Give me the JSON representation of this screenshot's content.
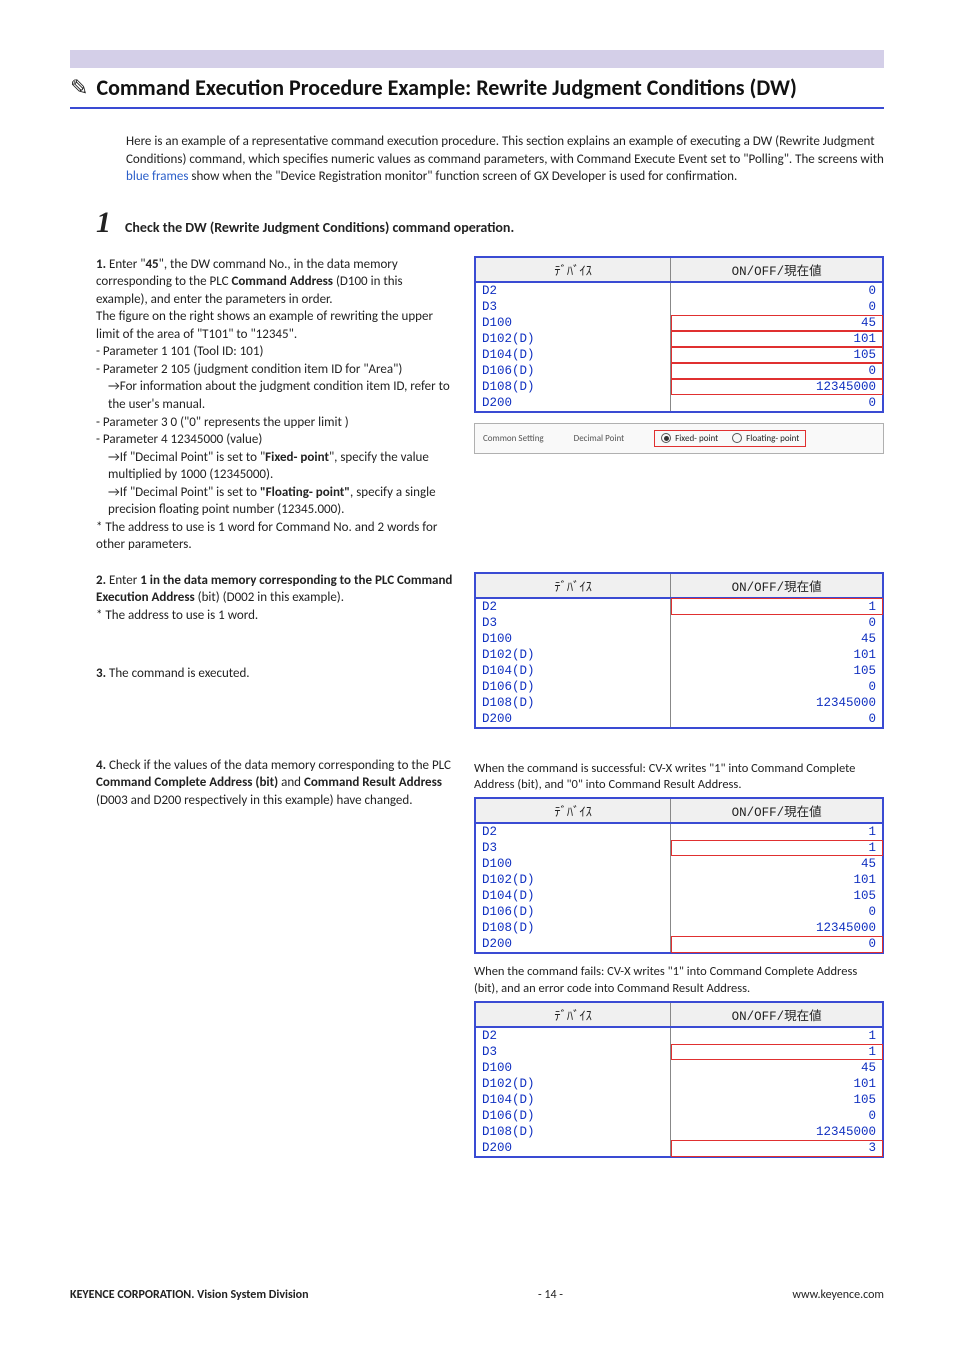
{
  "title": "Command Execution Procedure Example: Rewrite Judgment Conditions (DW)",
  "intro": {
    "p1a": "Here is an example of a representative command execution procedure. This section explains an example of executing a DW (Rewrite Judgment Conditions) command, which specifies numeric values as command parameters, with Command Execute Event set to \"Polling\".  The screens with ",
    "blue": "blue frames",
    "p1b": " show when the \"Device Registration monitor\" function screen of GX Developer is used for confirmation."
  },
  "step1": {
    "num": "1",
    "title": "Check the DW (Rewrite Judgment Conditions) command operation.",
    "s1": {
      "lead": "1.",
      "t1a": " Enter \"",
      "t1b": "45",
      "t1c": "\", the DW command No., in the data memory corresponding to the PLC ",
      "t1d": "Command Address",
      "t1e": " (D100 in this example), and enter the parameters in order.",
      "t2": "The figure on the right shows an example of rewriting the upper limit of the area of \"T101\" to \"12345\".",
      "p1": "- Parameter 1  101  (Tool ID: 101)",
      "p2": "- Parameter 2  105  (judgment condition item ID for \"Area\")",
      "p2a": "→For information about the judgment condition item ID, refer to the user's manual.",
      "p3": "- Parameter 3  0  (\"0\" represents the upper limit )",
      "p4": "- Parameter 4  12345000  (value)",
      "p4a_pre": "→If \"Decimal Point\" is set to \"",
      "p4a_b": "Fixed- point",
      "p4a_post": "\", specify the value multiplied by 1000 (12345000).",
      "p4b_pre": "→If \"Decimal Point\" is set to ",
      "p4b_b": "\"Floating- point\"",
      "p4b_post": ", specify a single precision floating point number (12345.000).",
      "note": "* The address to use is 1 word for Command No. and 2 words for other parameters."
    },
    "s2": {
      "lead": "2.",
      "t_pre": " Enter ",
      "t_b": "1 in the data memory corresponding to the PLC Command Execution Address",
      "t_post": " (bit) (D002 in this example).",
      "note": "* The address to use is 1 word."
    },
    "s3": {
      "lead": "3.",
      "t": " The command is executed."
    },
    "s4": {
      "lead": "4.",
      "t_pre": " Check if the values of the data memory corresponding to the PLC ",
      "t_b1": "Command Complete Address (bit)",
      "t_mid": " and ",
      "t_b2": "Command Result Address",
      "t_post": " (D003 and D200 respectively in this example) have changed."
    }
  },
  "tables": {
    "header_device": "ﾃﾞﾊﾞｲｽ",
    "header_value": "ON/OFF/現在値",
    "rows_labels": [
      "D2",
      "D3",
      "D100",
      "D102(D)",
      "D104(D)",
      "D106(D)",
      "D108(D)",
      "D200"
    ],
    "t1_values": [
      "0",
      "0",
      "45",
      "101",
      "105",
      "0",
      "12345000",
      "0"
    ],
    "t2_values": [
      "1",
      "0",
      "45",
      "101",
      "105",
      "0",
      "12345000",
      "0"
    ],
    "t3_values": [
      "1",
      "1",
      "45",
      "101",
      "105",
      "0",
      "12345000",
      "0"
    ],
    "t4_values": [
      "1",
      "1",
      "45",
      "101",
      "105",
      "0",
      "12345000",
      "3"
    ]
  },
  "setting": {
    "section": "Common Setting",
    "label": "Decimal Point",
    "opt1": "Fixed- point",
    "opt2": "Floating- point"
  },
  "captions": {
    "c3": "When the command is successful: CV-X writes \"1\" into Command Complete Address (bit), and \"0\" into Command Result Address.",
    "c4": "When the command fails: CV-X writes \"1\" into Command Complete Address (bit), and an error code into Command Result Address."
  },
  "footer": {
    "left": "KEYENCE CORPORATION. Vision System Division",
    "center": "- 14 -",
    "right": "www.keyence.com"
  }
}
